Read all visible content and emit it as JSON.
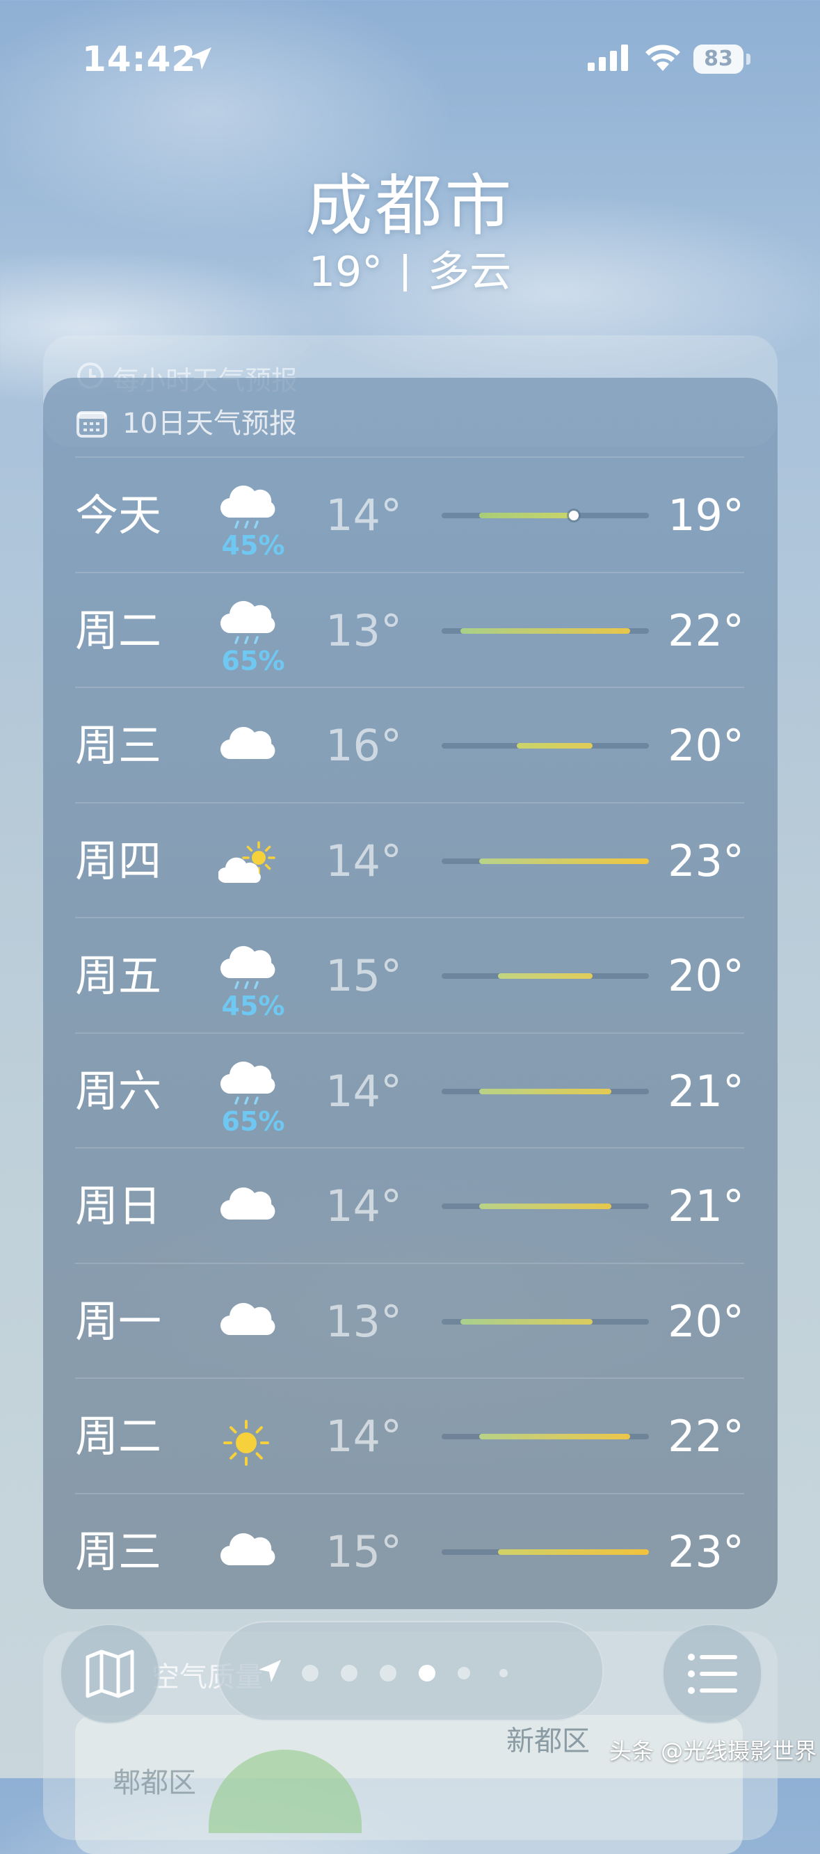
{
  "status_bar": {
    "time": "14:42",
    "battery": "83"
  },
  "header": {
    "city": "成都市",
    "temperature": "19°",
    "condition": "多云"
  },
  "hourly": {
    "title": "每小时天气预报"
  },
  "forecast": {
    "title": "10日天气预报",
    "days": [
      {
        "day": "今天",
        "icon": "rain-cloud-icon",
        "precip": "45%",
        "low": "14°",
        "high": "19°",
        "range": [
          14,
          19
        ],
        "current": 19,
        "colors": [
          "#a8cc78",
          "#c9d46a"
        ]
      },
      {
        "day": "周二",
        "icon": "rain-cloud-icon",
        "precip": "65%",
        "low": "13°",
        "high": "22°",
        "range": [
          13,
          22
        ],
        "colors": [
          "#a8d08a",
          "#e8c64a"
        ]
      },
      {
        "day": "周三",
        "icon": "cloud-icon",
        "precip": "",
        "low": "16°",
        "high": "20°",
        "range": [
          16,
          20
        ],
        "colors": [
          "#c9d46a",
          "#e0cc58"
        ]
      },
      {
        "day": "周四",
        "icon": "partly-sunny-icon",
        "precip": "",
        "low": "14°",
        "high": "23°",
        "range": [
          14,
          23
        ],
        "colors": [
          "#b8d28a",
          "#f0c640"
        ]
      },
      {
        "day": "周五",
        "icon": "rain-cloud-icon",
        "precip": "45%",
        "low": "15°",
        "high": "20°",
        "range": [
          15,
          20
        ],
        "colors": [
          "#c2d482",
          "#e0cc5a"
        ]
      },
      {
        "day": "周六",
        "icon": "rain-cloud-icon",
        "precip": "65%",
        "low": "14°",
        "high": "21°",
        "range": [
          14,
          21
        ],
        "colors": [
          "#b8d288",
          "#e4ca52"
        ]
      },
      {
        "day": "周日",
        "icon": "cloud-icon",
        "precip": "",
        "low": "14°",
        "high": "21°",
        "range": [
          14,
          21
        ],
        "colors": [
          "#b8d288",
          "#e8c84c"
        ]
      },
      {
        "day": "周一",
        "icon": "cloud-icon",
        "precip": "",
        "low": "13°",
        "high": "20°",
        "range": [
          13,
          20
        ],
        "colors": [
          "#a8d08e",
          "#dccc5e"
        ]
      },
      {
        "day": "周二",
        "icon": "sun-icon",
        "precip": "",
        "low": "14°",
        "high": "22°",
        "range": [
          14,
          22
        ],
        "colors": [
          "#b8d288",
          "#ecc64a"
        ]
      },
      {
        "day": "周三",
        "icon": "cloud-icon",
        "precip": "",
        "low": "15°",
        "high": "23°",
        "range": [
          15,
          23
        ],
        "colors": [
          "#cfd26a",
          "#f2c23c"
        ]
      }
    ],
    "scale": [
      12,
      23
    ]
  },
  "air_quality": {
    "title": "空气质量",
    "map_labels": [
      "新都区",
      "郫都区"
    ]
  },
  "pager": {
    "count": 7,
    "active": 4
  },
  "watermark": "头条 @光线摄影世界"
}
